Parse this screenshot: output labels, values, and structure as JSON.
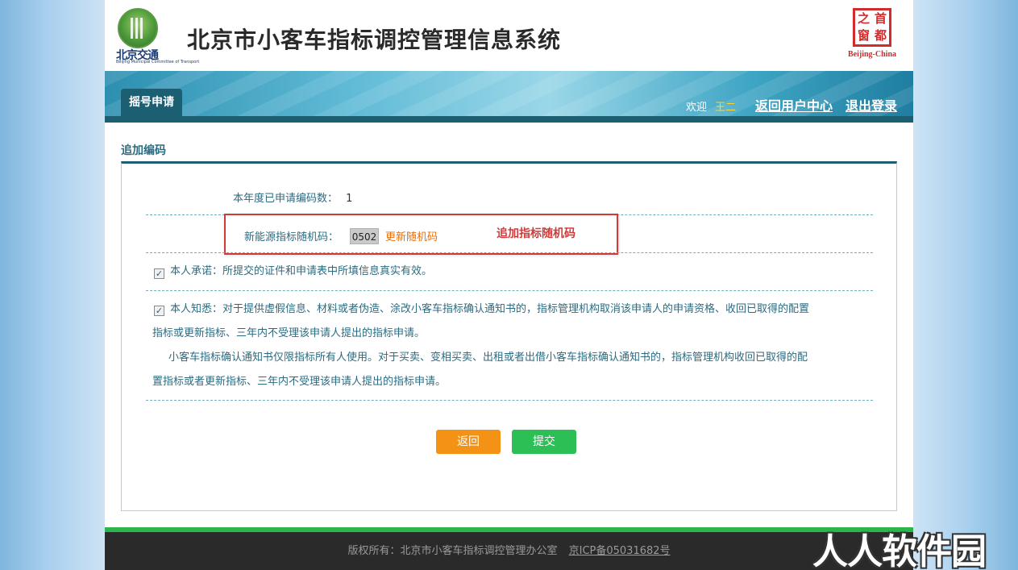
{
  "header": {
    "logo_left_text": "北京交通",
    "logo_left_sub": "Beijing Municipal Committee of Transport",
    "title": "北京市小客车指标调控管理信息系统",
    "logo_right_chars": [
      "之",
      "首",
      "窗",
      "都"
    ],
    "logo_right_label": "Beijing-China"
  },
  "nav": {
    "tab_label": "摇号申请",
    "welcome": "欢迎",
    "username": "王二",
    "link_user_center": "返回用户中心",
    "link_logout": "退出登录"
  },
  "section_title": "追加编码",
  "form": {
    "count_label": "本年度已申请编码数：",
    "count_value": "1",
    "random_code_label": "新能源指标随机码：",
    "random_code_value": "0502",
    "refresh_link": "更新随机码",
    "annotation": "追加指标随机码",
    "promise_text": "本人承诺：所提交的证件和申请表中所填信息真实有效。",
    "notice_line1": "本人知悉：对于提供虚假信息、材料或者伪造、涂改小客车指标确认通知书的，指标管理机构取消该申请人的申请资格、收回已取得的配置",
    "notice_line2": "指标或更新指标、三年内不受理该申请人提出的指标申请。",
    "notice_line3": "小客车指标确认通知书仅限指标所有人使用。对于买卖、变相买卖、出租或者出借小客车指标确认通知书的，指标管理机构收回已取得的配",
    "notice_line4": "置指标或者更新指标、三年内不受理该申请人提出的指标申请。",
    "checkbox_mark": "✓"
  },
  "buttons": {
    "back": "返回",
    "submit": "提交"
  },
  "footer": {
    "copyright": "版权所有：北京市小客车指标调控管理办公室",
    "icp": "京ICP备05031682号"
  },
  "watermark": "人人软件园"
}
